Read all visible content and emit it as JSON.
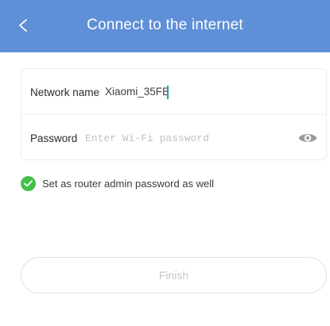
{
  "header": {
    "title": "Connect to the internet",
    "back_icon": "chevron-left-icon",
    "background_color": "#5f8fd6"
  },
  "form": {
    "network": {
      "label": "Network name",
      "value": "Xiaomi_35FB"
    },
    "password": {
      "label": "Password",
      "placeholder": "Enter Wi-Fi password",
      "value": "",
      "toggle_icon": "eye-icon"
    }
  },
  "admin_option": {
    "label": "Set as router admin password as well",
    "checked": true,
    "check_color": "#44c149",
    "icon": "check-icon"
  },
  "actions": {
    "finish_label": "Finish",
    "enabled": false
  }
}
